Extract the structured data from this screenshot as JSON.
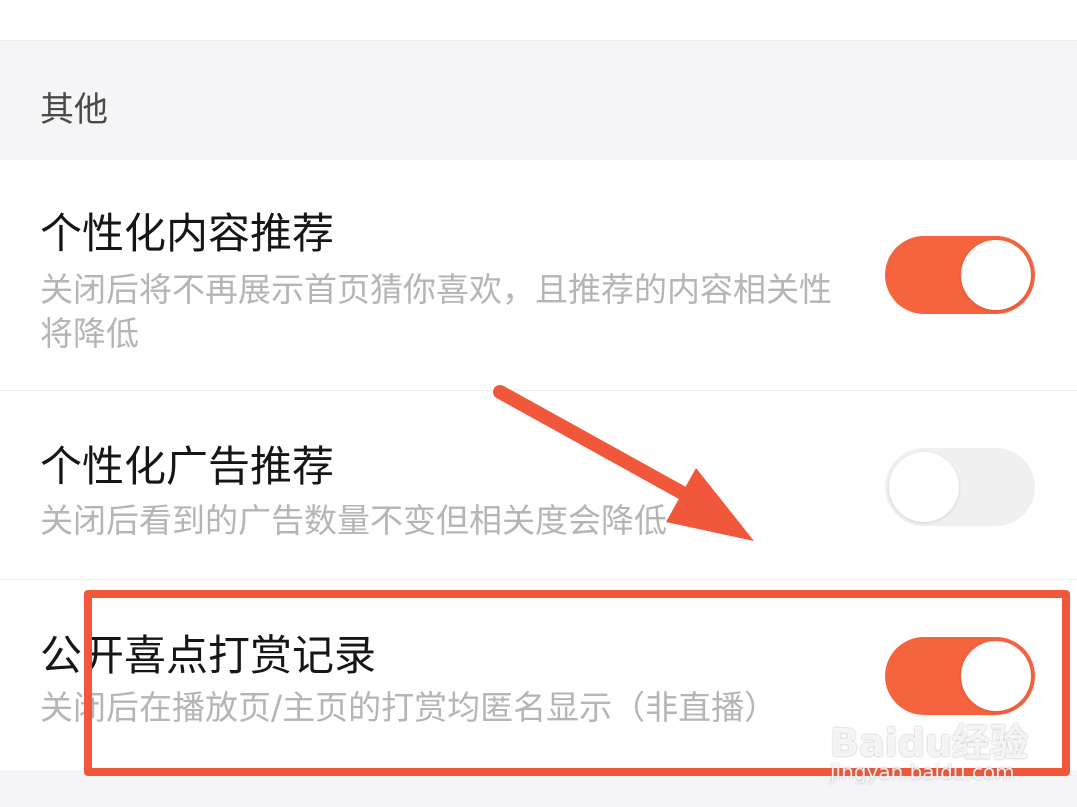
{
  "section": {
    "title": "其他"
  },
  "settings": [
    {
      "title": "个性化内容推荐",
      "description": "关闭后将不再展示首页猜你喜欢，且推荐的内容相关性将降低",
      "enabled": true
    },
    {
      "title": "个性化广告推荐",
      "description": "关闭后看到的广告数量不变但相关度会降低",
      "enabled": false
    },
    {
      "title": "公开喜点打赏记录",
      "description": "关闭后在播放页/主页的打赏均匿名显示（非直播）",
      "enabled": true
    }
  ],
  "watermark": {
    "logo": "Baidu经验",
    "url": "jingyan.baidu.com"
  },
  "colors": {
    "accent": "#f6633f",
    "annotation": "#f1573a",
    "toggle_off": "#f0f0f0",
    "background": "#f5f5f7"
  }
}
